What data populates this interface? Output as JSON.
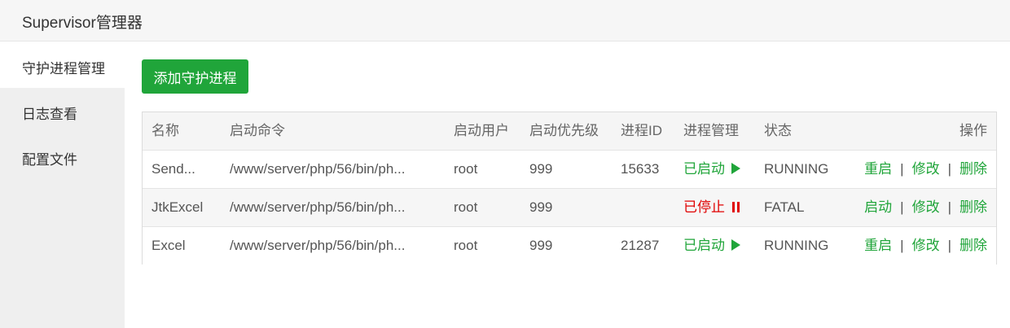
{
  "app": {
    "title": "Supervisor管理器"
  },
  "sidebar": {
    "items": [
      {
        "label": "守护进程管理",
        "active": true
      },
      {
        "label": "日志查看",
        "active": false
      },
      {
        "label": "配置文件",
        "active": false
      }
    ]
  },
  "toolbar": {
    "add_label": "添加守护进程"
  },
  "table": {
    "headers": [
      "名称",
      "启动命令",
      "启动用户",
      "启动优先级",
      "进程ID",
      "进程管理",
      "状态",
      "操作"
    ],
    "rows": [
      {
        "name": "Send...",
        "command": "/www/server/php/56/bin/ph...",
        "user": "root",
        "priority": "999",
        "pid": "15633",
        "manage": "已启动",
        "manage_icon": "play-icon",
        "status": "RUNNING",
        "op1": "重启",
        "op2": "修改",
        "op3": "删除"
      },
      {
        "name": "JtkExcel",
        "command": "/www/server/php/56/bin/ph...",
        "user": "root",
        "priority": "999",
        "pid": "",
        "manage": "已停止",
        "manage_icon": "pause-icon",
        "status": "FATAL",
        "op1": "启动",
        "op2": "修改",
        "op3": "删除"
      },
      {
        "name": "Excel",
        "command": "/www/server/php/56/bin/ph...",
        "user": "root",
        "priority": "999",
        "pid": "21287",
        "manage": "已启动",
        "manage_icon": "play-icon",
        "status": "RUNNING",
        "op1": "重启",
        "op2": "修改",
        "op3": "删除"
      }
    ],
    "separator": "|"
  },
  "colors": {
    "accent": "#20a53a",
    "stopped": "#e00000"
  }
}
